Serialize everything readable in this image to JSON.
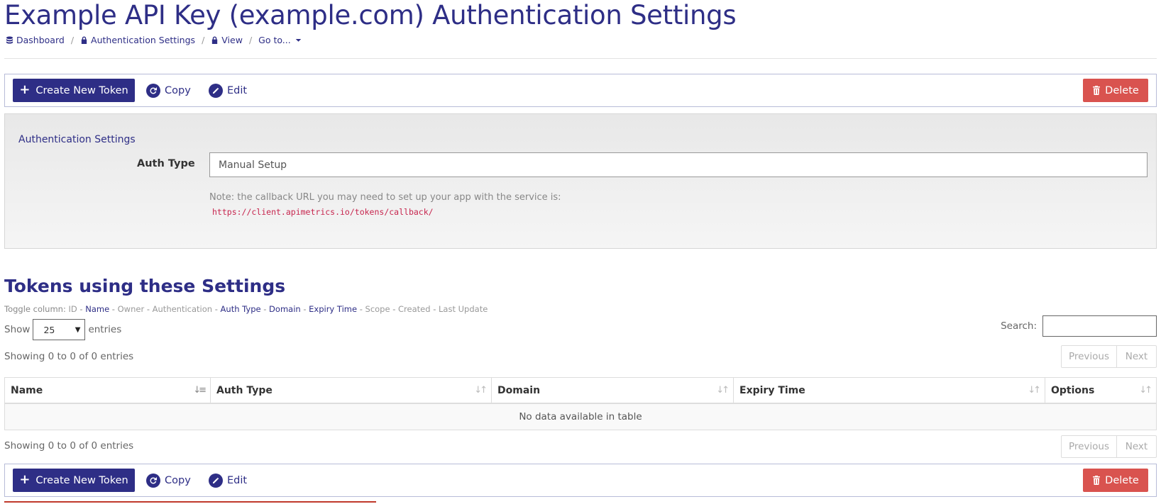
{
  "page": {
    "title": "Example API Key (example.com) Authentication Settings"
  },
  "breadcrumb": {
    "items": [
      {
        "label": "Dashboard",
        "icon": "database-icon"
      },
      {
        "label": "Authentication Settings",
        "icon": "lock-icon"
      },
      {
        "label": "View",
        "icon": "lock-icon"
      },
      {
        "label": "Go to...",
        "icon": "caret-down-icon"
      }
    ]
  },
  "toolbar": {
    "create_label": "Create New Token",
    "copy_label": "Copy",
    "edit_label": "Edit",
    "delete_label": "Delete"
  },
  "settings": {
    "heading": "Authentication Settings",
    "auth_type_label": "Auth Type",
    "auth_type_value": "Manual Setup",
    "note": "Note: the callback URL you may need to set up your app with the service is:",
    "callback_url": "https://client.apimetrics.io/tokens/callback/"
  },
  "tokens": {
    "title": "Tokens using these Settings",
    "toggle_prefix": "Toggle column:",
    "toggle_columns": [
      {
        "label": "ID",
        "visible": false
      },
      {
        "label": "Name",
        "visible": true
      },
      {
        "label": "Owner",
        "visible": false
      },
      {
        "label": "Authentication",
        "visible": false
      },
      {
        "label": "Auth Type",
        "visible": true
      },
      {
        "label": "Domain",
        "visible": true
      },
      {
        "label": "Expiry Time",
        "visible": true
      },
      {
        "label": "Scope",
        "visible": false
      },
      {
        "label": "Created",
        "visible": false
      },
      {
        "label": "Last Update",
        "visible": false
      }
    ],
    "show_label": "Show",
    "entries_label": "entries",
    "page_size": "25",
    "search_label": "Search:",
    "info_text": "Showing 0 to 0 of 0 entries",
    "prev_label": "Previous",
    "next_label": "Next",
    "columns": [
      "Name",
      "Auth Type",
      "Domain",
      "Expiry Time",
      "Options"
    ],
    "empty_text": "No data available in table"
  },
  "colors": {
    "primary": "#2e2e86",
    "danger": "#d9534f",
    "code": "#c7254e"
  }
}
